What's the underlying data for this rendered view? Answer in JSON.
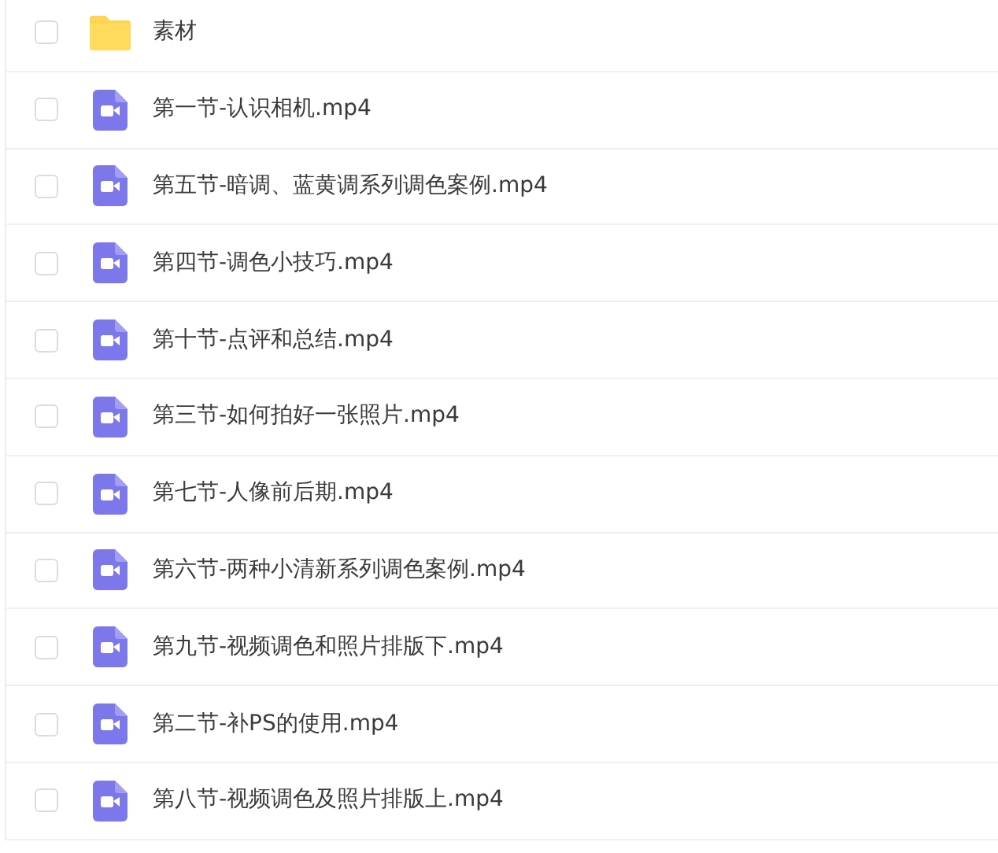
{
  "files": [
    {
      "kind": "folder",
      "name": "素材",
      "checked": false
    },
    {
      "kind": "video",
      "name": "第一节-认识相机.mp4",
      "checked": false
    },
    {
      "kind": "video",
      "name": "第五节-暗调、蓝黄调系列调色案例.mp4",
      "checked": false
    },
    {
      "kind": "video",
      "name": "第四节-调色小技巧.mp4",
      "checked": false
    },
    {
      "kind": "video",
      "name": "第十节-点评和总结.mp4",
      "checked": false
    },
    {
      "kind": "video",
      "name": "第三节-如何拍好一张照片.mp4",
      "checked": false
    },
    {
      "kind": "video",
      "name": "第七节-人像前后期.mp4",
      "checked": false
    },
    {
      "kind": "video",
      "name": "第六节-两种小清新系列调色案例.mp4",
      "checked": false
    },
    {
      "kind": "video",
      "name": "第九节-视频调色和照片排版下.mp4",
      "checked": false
    },
    {
      "kind": "video",
      "name": "第二节-补PS的使用.mp4",
      "checked": false
    },
    {
      "kind": "video",
      "name": "第八节-视频调色及照片排版上.mp4",
      "checked": false
    }
  ]
}
